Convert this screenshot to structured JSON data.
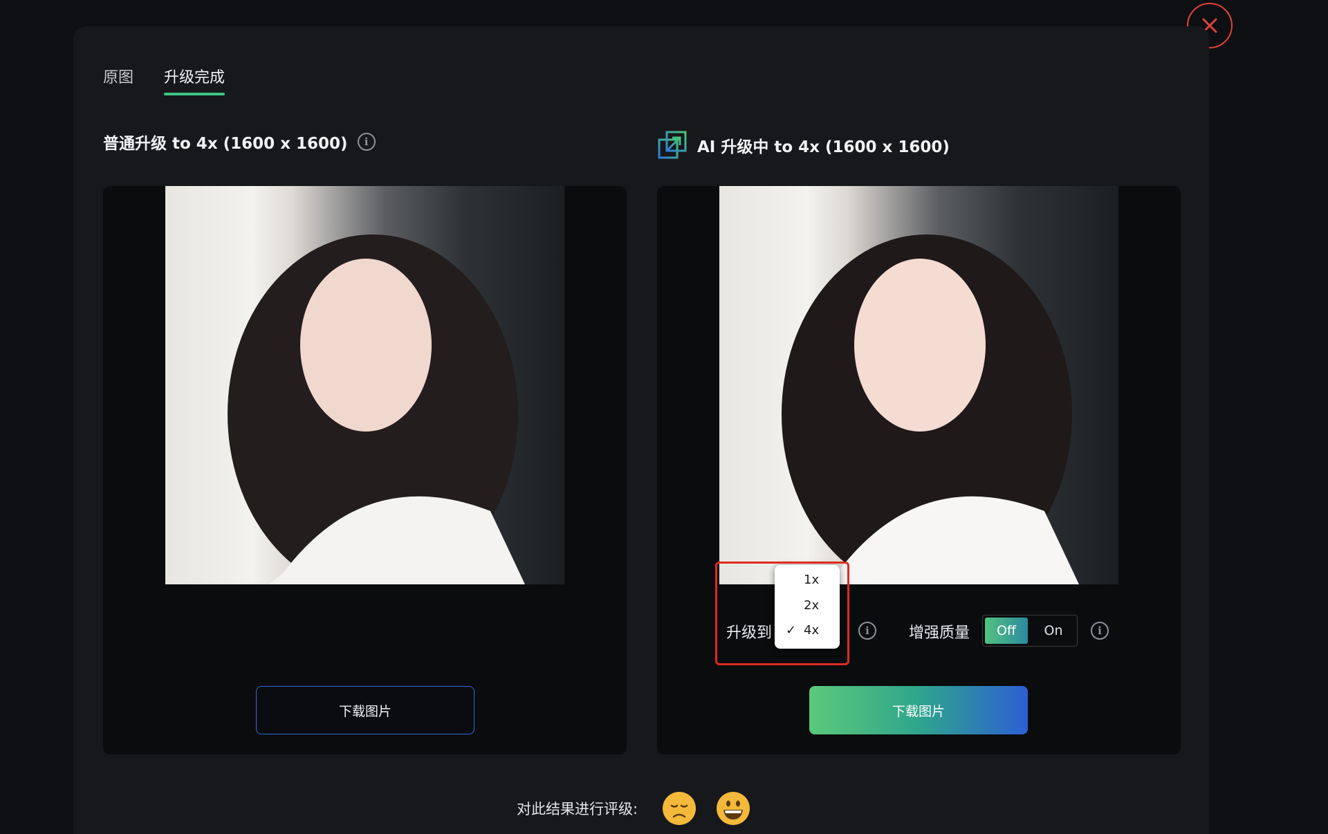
{
  "tabs": [
    {
      "label": "原图"
    },
    {
      "label": "升级完成"
    }
  ],
  "left": {
    "title": "普通升级 to 4x (1600 x 1600)",
    "download_label": "下载图片"
  },
  "right": {
    "title": "AI 升级中 to 4x (1600 x 1600)",
    "download_label": "下载图片"
  },
  "scale": {
    "label": "升级到",
    "options": [
      "1x",
      "2x",
      "4x"
    ],
    "selected": "4x"
  },
  "enhance": {
    "label": "增强质量",
    "off_label": "Off",
    "on_label": "On",
    "state": "Off"
  },
  "rating": {
    "label": "对此结果进行评级:"
  },
  "icons": {
    "close": "close-icon",
    "info": "info-icon",
    "upscale": "upscale-icon",
    "check": "check-icon",
    "sad": "sad-face-icon",
    "happy": "happy-face-icon"
  },
  "colors": {
    "accent_green": "#3dc488",
    "accent_blue": "#2d5fd3",
    "highlight_red": "#e02a22",
    "close_red": "#e0443a"
  }
}
